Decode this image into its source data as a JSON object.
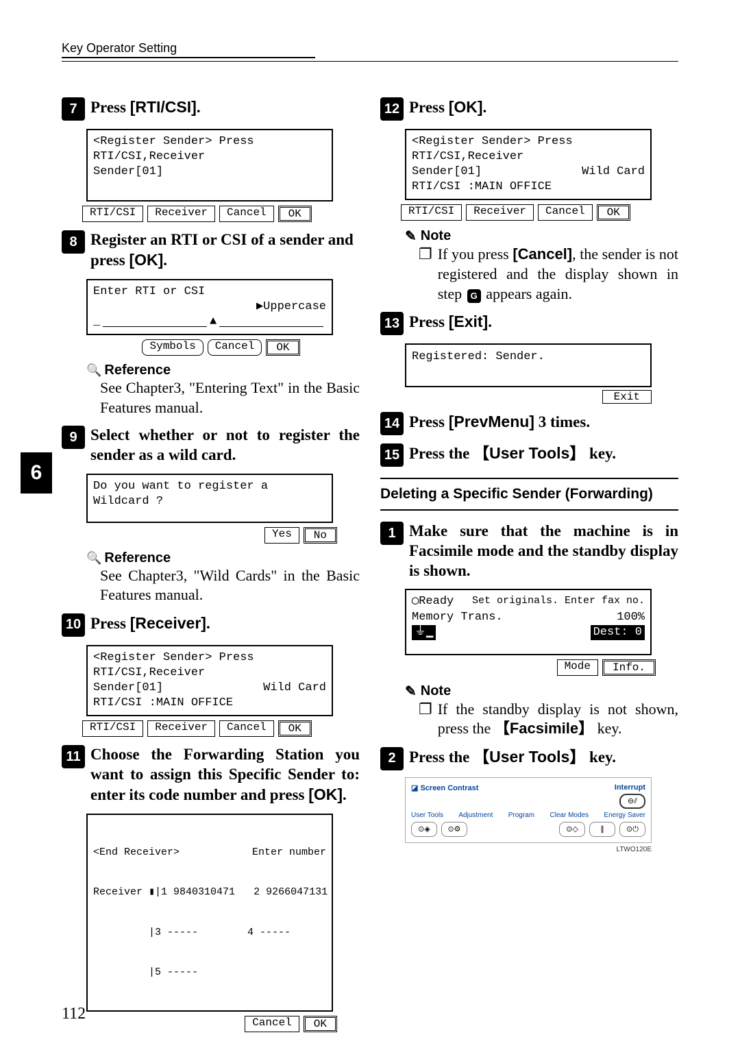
{
  "header": {
    "section": "Key Operator Setting"
  },
  "sidetab": "6",
  "pagenum": "112",
  "left": {
    "s7": {
      "text": "Press ",
      "btn": "[RTI/CSI]",
      "tail": "."
    },
    "lcd7": {
      "l1": "<Register Sender> Press RTI/CSI,Receiver",
      "l2": "Sender[01]"
    },
    "sk7": {
      "a": "RTI/CSI",
      "b": "Receiver",
      "c": "Cancel",
      "d": "OK"
    },
    "s8": {
      "text": "Register an RTI or CSI of a sender and press ",
      "btn": "[OK]",
      "tail": "."
    },
    "lcd8": {
      "l1": "Enter RTI or CSI",
      "r1": "▶Uppercase",
      "cursor": "_",
      "caret": "▲"
    },
    "sk8": {
      "a": "Symbols",
      "b": "Cancel",
      "c": "OK"
    },
    "ref8": {
      "head": "Reference",
      "body": "See Chapter3, \"Entering Text\" in the Basic Features manual."
    },
    "s9": {
      "text": "Select whether or not to register the sender as a wild card."
    },
    "lcd9": {
      "l1": "Do you want to register a Wildcard ?"
    },
    "sk9": {
      "a": "Yes",
      "b": "No"
    },
    "ref9": {
      "head": "Reference",
      "body": "See Chapter3, \"Wild Cards\" in the Basic Features manual."
    },
    "s10": {
      "text": "Press ",
      "btn": "[Receiver]",
      "tail": "."
    },
    "lcd10": {
      "l1": "<Register Sender> Press RTI/CSI,Receiver",
      "l2a": "Sender[01]",
      "l2b": "Wild Card",
      "l3": "RTI/CSI :MAIN OFFICE"
    },
    "sk10": {
      "a": "RTI/CSI",
      "b": "Receiver",
      "c": "Cancel",
      "d": "OK"
    },
    "s11": {
      "text": "Choose the Forwarding Station you want to assign this Specific Sender to: enter its code number and press ",
      "btn": "[OK]",
      "tail": "."
    },
    "lcd11": {
      "l1a": "<End Receiver>",
      "l1b": "Enter number",
      "l2": "Receiver ▮|1 9840310471   2 9266047131",
      "l3": "         |3 -----        4 -----",
      "l4": "         |5 -----"
    },
    "sk11": {
      "a": "Cancel",
      "b": "OK"
    }
  },
  "right": {
    "s12": {
      "text": "Press ",
      "btn": "[OK]",
      "tail": "."
    },
    "lcd12": {
      "l1": "<Register Sender> Press RTI/CSI,Receiver",
      "l2a": "Sender[01]",
      "l2b": "Wild Card",
      "l3": "RTI/CSI :MAIN OFFICE"
    },
    "sk12": {
      "a": "RTI/CSI",
      "b": "Receiver",
      "c": "Cancel",
      "d": "OK"
    },
    "note12": {
      "head": "Note",
      "body1a": "If you press ",
      "body1b": "[Cancel]",
      "body1c": ", the sender is not registered and the display shown in step ",
      "body1d": " appears again.",
      "stepref": "G"
    },
    "s13": {
      "text": "Press ",
      "btn": "[Exit]",
      "tail": "."
    },
    "lcd13": {
      "l1": "Registered: Sender."
    },
    "sk13": {
      "a": "Exit"
    },
    "s14": {
      "text": "Press ",
      "btn": "[PrevMenu]",
      "tail": " 3 times."
    },
    "s15": {
      "text": "Press the ",
      "bracket": "User Tools",
      "tail": " key."
    },
    "delete_head": "Deleting a Specific Sender (Forwarding)",
    "d1": {
      "text": "Make sure that the machine is in Facsimile mode and the standby display is shown."
    },
    "lcdd1": {
      "l1a": "◯Ready",
      "l1b": "Set originals. Enter fax no.",
      "l2a": "Memory Trans.",
      "l2b": "100%",
      "l3a": "⏚▁",
      "l3b": "Dest:  0"
    },
    "skd1": {
      "a": "Mode",
      "b": "Info."
    },
    "noted1": {
      "head": "Note",
      "body1a": "If the standby display is not shown, press the ",
      "bracket": "Facsimile",
      "body1b": " key."
    },
    "d2": {
      "text": "Press the ",
      "bracket": "User Tools",
      "tail": " key."
    },
    "panel": {
      "sc": "Screen Contrast",
      "int": "Interrupt",
      "ut": "User Tools",
      "adj": "Adjustment",
      "prog": "Program",
      "cm": "Clear Modes",
      "es": "Energy Saver"
    },
    "panelcap": "LTWO120E"
  }
}
